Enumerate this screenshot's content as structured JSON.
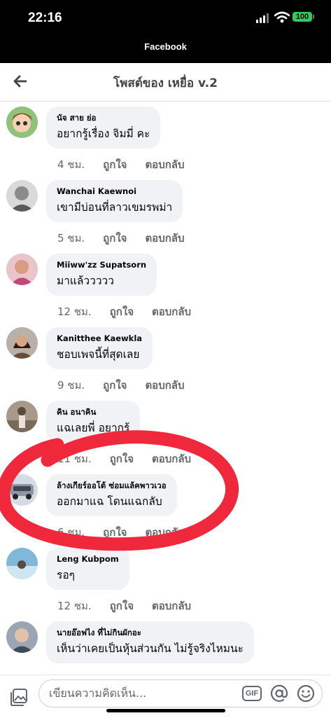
{
  "status_bar": {
    "time": "22:16",
    "app_label": "Facebook",
    "battery": "100"
  },
  "nav": {
    "title": "โพสต์ของ เหยื่อ v.2"
  },
  "comments": [
    {
      "name": "นัจ สาย ย่อ",
      "text": "อยากรู้เรื่อง จิมมี่ คะ",
      "time": "4 ชม.",
      "like": "ถูกใจ",
      "reply": "ตอบกลับ"
    },
    {
      "name": "Wanchai Kaewnoi",
      "text": "เขามีบ่อนที่ลาวเขมรพม่า",
      "time": "5 ชม.",
      "like": "ถูกใจ",
      "reply": "ตอบกลับ"
    },
    {
      "name": "Miiww'zz Supatsorn",
      "text": "มาแล้ววววว",
      "time": "12 ชม.",
      "like": "ถูกใจ",
      "reply": "ตอบกลับ"
    },
    {
      "name": "Kanitthee Kaewkla",
      "text": "ชอบเพจนี้ที่สุดเลย",
      "time": "9 ชม.",
      "like": "ถูกใจ",
      "reply": "ตอบกลับ"
    },
    {
      "name": "คิน อนาคิน",
      "text": "แฉเลยพี่ อยากรู้",
      "time": "11 ชม.",
      "like": "ถูกใจ",
      "reply": "ตอบกลับ"
    },
    {
      "name": "ล้างเกียร์ออโต้ ซ่อมแล้คพาวเวอ",
      "text": "ออกมาแฉ โดนแฉกลับ",
      "time": "6 ชม.",
      "like": "ถูกใจ",
      "reply": "ตอบกลับ"
    },
    {
      "name": "Leng Kubpom",
      "text": "รอๆ",
      "time": "12 ชม.",
      "like": "ถูกใจ",
      "reply": "ตอบกลับ"
    },
    {
      "name": "นายอ๊อฟไง ที่ไม่กินผักอะ",
      "text": "เห็นว่าเคยเป็นหุ้นส่วนกัน ไม่รู้จริงไหมนะ",
      "time": "",
      "like": "",
      "reply": ""
    }
  ],
  "composer": {
    "placeholder": "เขียนความคิดเห็น...",
    "gif_label": "GIF"
  },
  "colors": {
    "annotation": "#f0283c",
    "bubble": "#f0f2f5",
    "meta_text": "#65676b"
  }
}
